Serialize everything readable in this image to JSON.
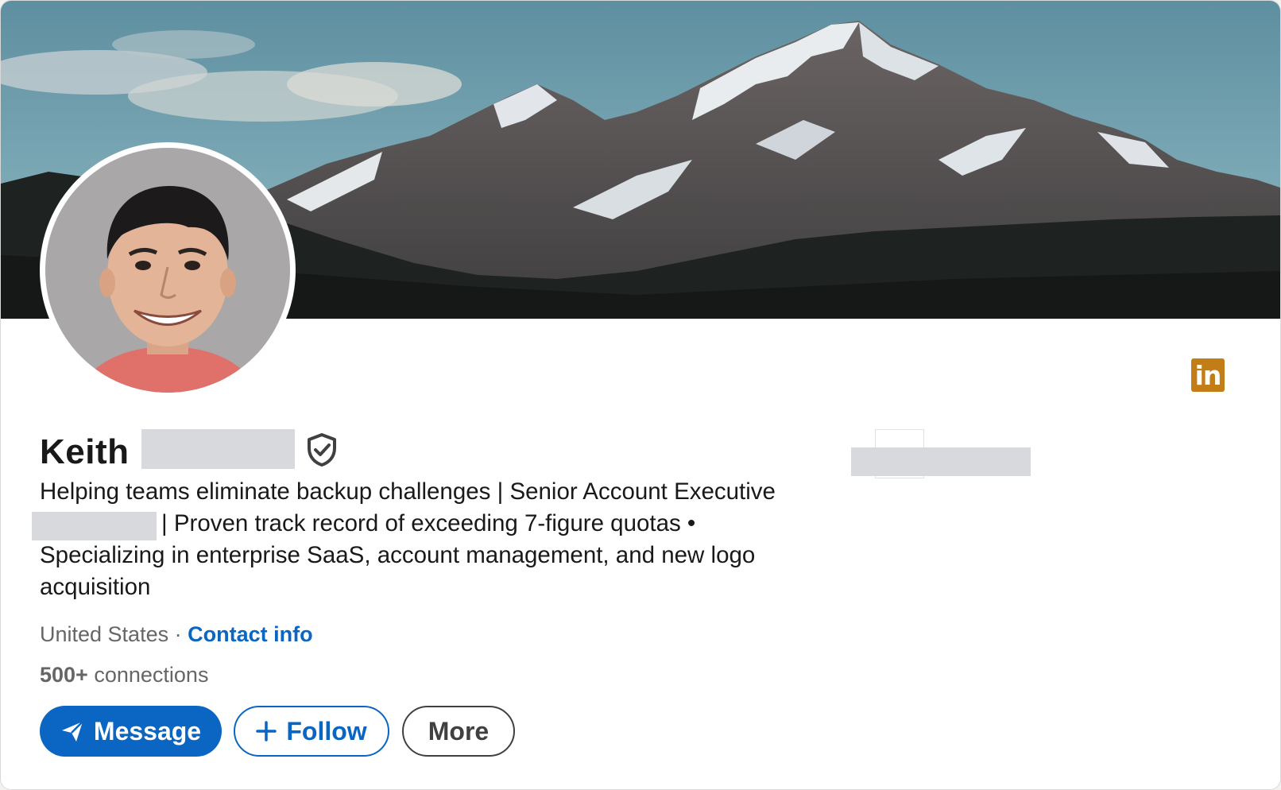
{
  "profile": {
    "first_name": "Keith",
    "headline_lines": [
      "Helping teams eliminate backup challenges | Senior Account Executive",
      "| Proven track record of exceeding 7-figure quotas •",
      "Specializing in enterprise SaaS, account management, and new logo",
      "acquisition"
    ],
    "location": "United States",
    "separator": "·",
    "contact_info_label": "Contact info",
    "connections_count": "500+",
    "connections_label": "connections"
  },
  "icons": {
    "verified": "shield-check-icon",
    "brand": "linkedin-icon",
    "message": "paper-plane-icon",
    "follow": "plus-icon"
  },
  "brand_logo_text": "in",
  "actions": {
    "message_label": "Message",
    "follow_label": "Follow",
    "more_label": "More"
  },
  "colors": {
    "primary": "#0a66c2",
    "brand_badge": "#c37d16",
    "text": "#191919",
    "muted": "#666666",
    "redaction": "#d8d9dc"
  }
}
